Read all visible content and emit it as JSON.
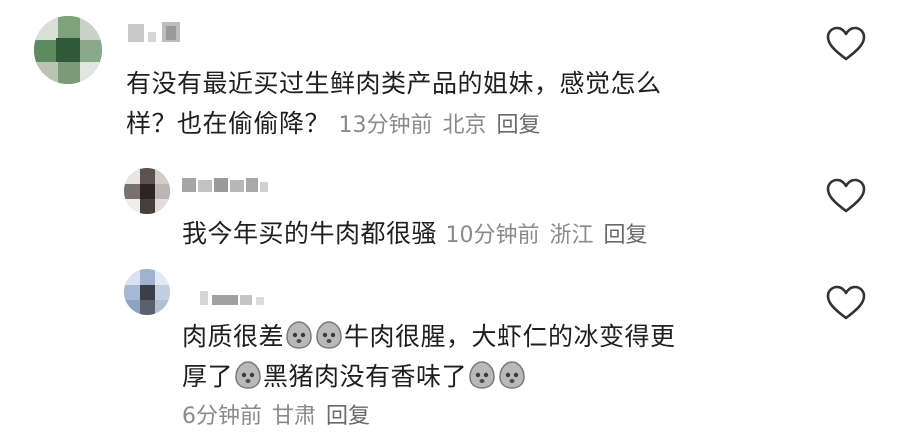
{
  "comments": [
    {
      "username": "",
      "text": "有没有最近买过生鲜肉类产品的姐妹，感觉怎么样？也在偷偷降？",
      "text_line1": "有没有最近买过生鲜肉类产品的姐妹，感觉怎么",
      "text_line2": "样？也在偷偷降？",
      "time": "13分钟前",
      "location": "北京",
      "reply": "回复"
    },
    {
      "username": "",
      "text": "我今年买的牛肉都很骚",
      "time": "10分钟前",
      "location": "浙江",
      "reply": "回复"
    },
    {
      "username": "",
      "text_part1": "肉质很差",
      "text_part2": "牛肉很腥，大虾仁的冰变得更",
      "text_part3": "厚了",
      "text_part4": "黑猪肉没有香味了",
      "time": "6分钟前",
      "location": "甘肃",
      "reply": "回复"
    }
  ],
  "icons": {
    "like": "heart-outline-icon",
    "emoji": "crying-face-emoji"
  },
  "colors": {
    "text": "#1f1f1f",
    "meta": "#8a8a8a",
    "icon": "#333333"
  }
}
